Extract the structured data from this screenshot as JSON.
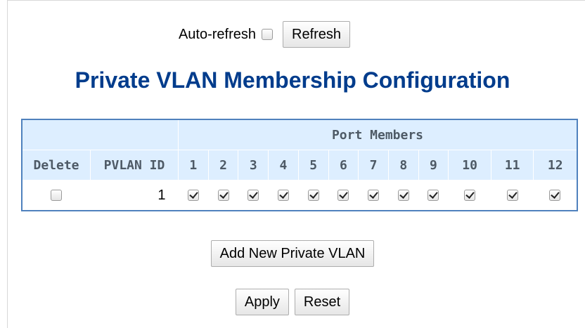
{
  "toolbar": {
    "auto_refresh_label": "Auto-refresh",
    "refresh_label": "Refresh"
  },
  "page": {
    "title": "Private VLAN Membership Configuration"
  },
  "table": {
    "group_header": "Port Members",
    "delete_header": "Delete",
    "pvlan_id_header": "PVLAN ID",
    "ports": [
      "1",
      "2",
      "3",
      "4",
      "5",
      "6",
      "7",
      "8",
      "9",
      "10",
      "11",
      "12"
    ],
    "rows": [
      {
        "delete": false,
        "pvlan_id": "1",
        "members": [
          true,
          true,
          true,
          true,
          true,
          true,
          true,
          true,
          true,
          true,
          true,
          true
        ]
      }
    ]
  },
  "actions": {
    "add_label": "Add New Private VLAN",
    "apply_label": "Apply",
    "reset_label": "Reset"
  },
  "colors": {
    "title": "#003c8c",
    "header_bg": "#ddeeff",
    "table_border": "#4f81bd"
  }
}
